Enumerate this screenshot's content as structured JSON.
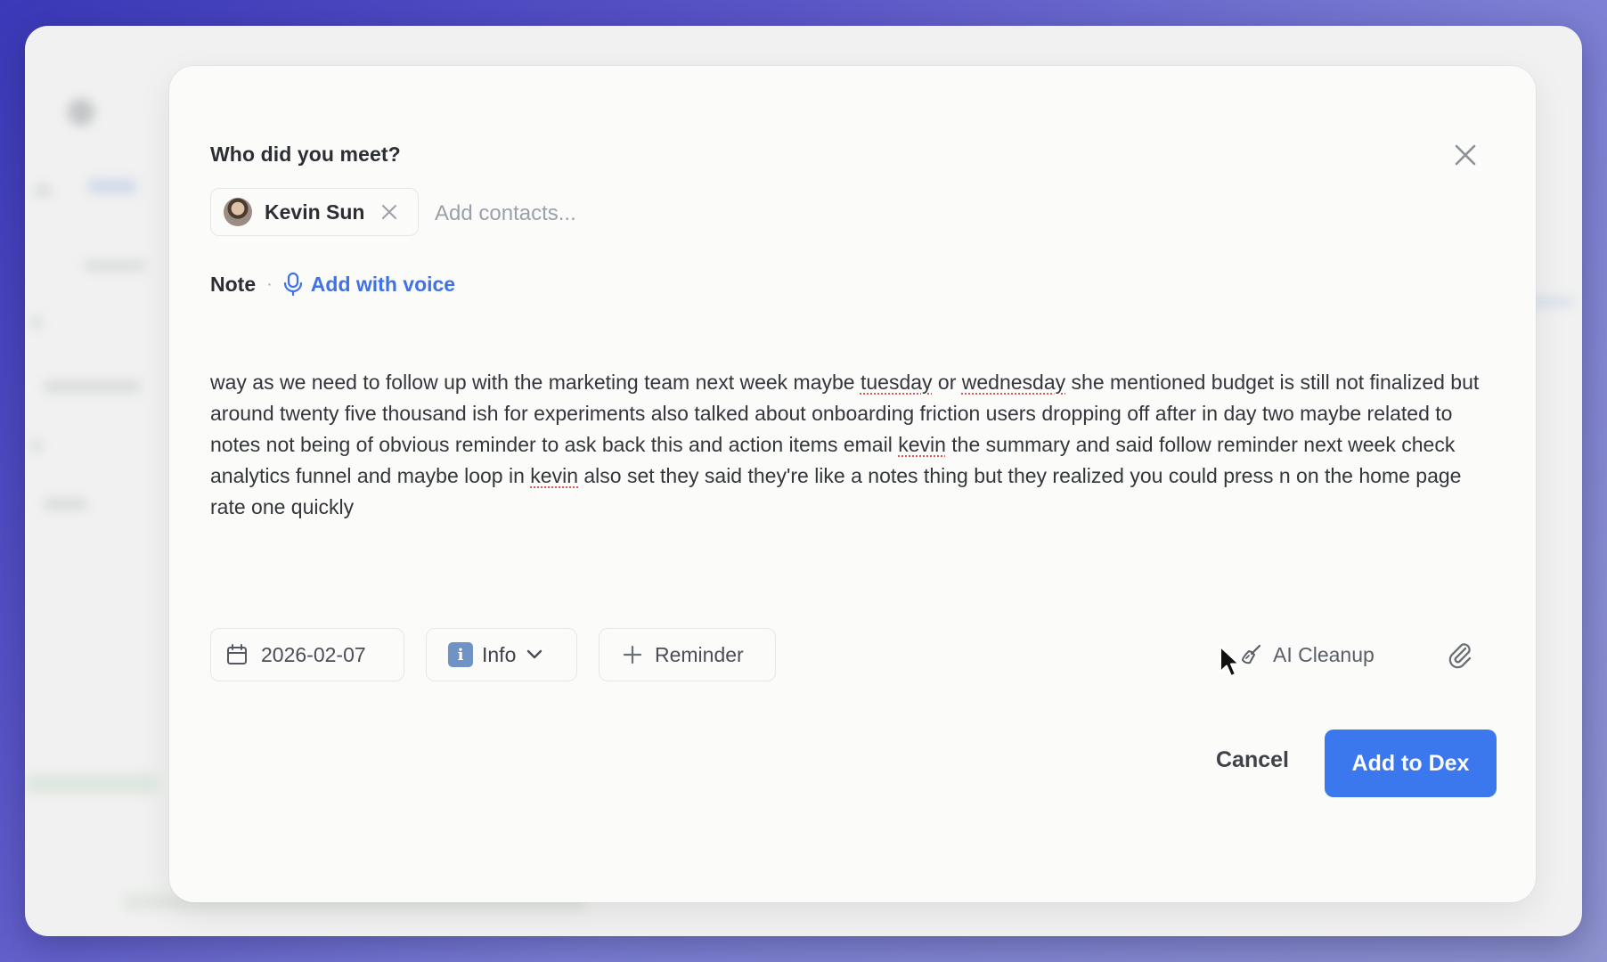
{
  "dialog": {
    "title": "Who did you meet?",
    "contacts": [
      {
        "name": "Kevin Sun"
      }
    ],
    "add_contacts_placeholder": "Add contacts...",
    "note_label": "Note",
    "separator": "·",
    "add_with_voice": "Add with voice",
    "note_segments": [
      "way as we need to follow up with the marketing team next week maybe ",
      "tuesday",
      " or ",
      "wednesday",
      " she mentioned budget is still not finalized but around twenty five thousand ish for experiments also talked about onboarding friction users dropping off after in day two maybe related to notes not being of obvious reminder to ask back this and action items email ",
      "kevin",
      " the summary and said follow reminder next week check analytics funnel and maybe loop in ",
      "kevin",
      " also set they said they're like a notes thing but they realized you could press n on the home page rate one quickly"
    ],
    "toolbar": {
      "date": "2026-02-07",
      "type_icon_letter": "i",
      "type_label": "Info",
      "reminder_label": "Reminder",
      "ai_cleanup_label": "AI Cleanup"
    },
    "cancel_label": "Cancel",
    "submit_label": "Add to Dex"
  },
  "colors": {
    "accent": "#3b78ee",
    "link": "#3f72e6",
    "type_icon": "#6f93c4",
    "spellcheck": "#e25555"
  }
}
